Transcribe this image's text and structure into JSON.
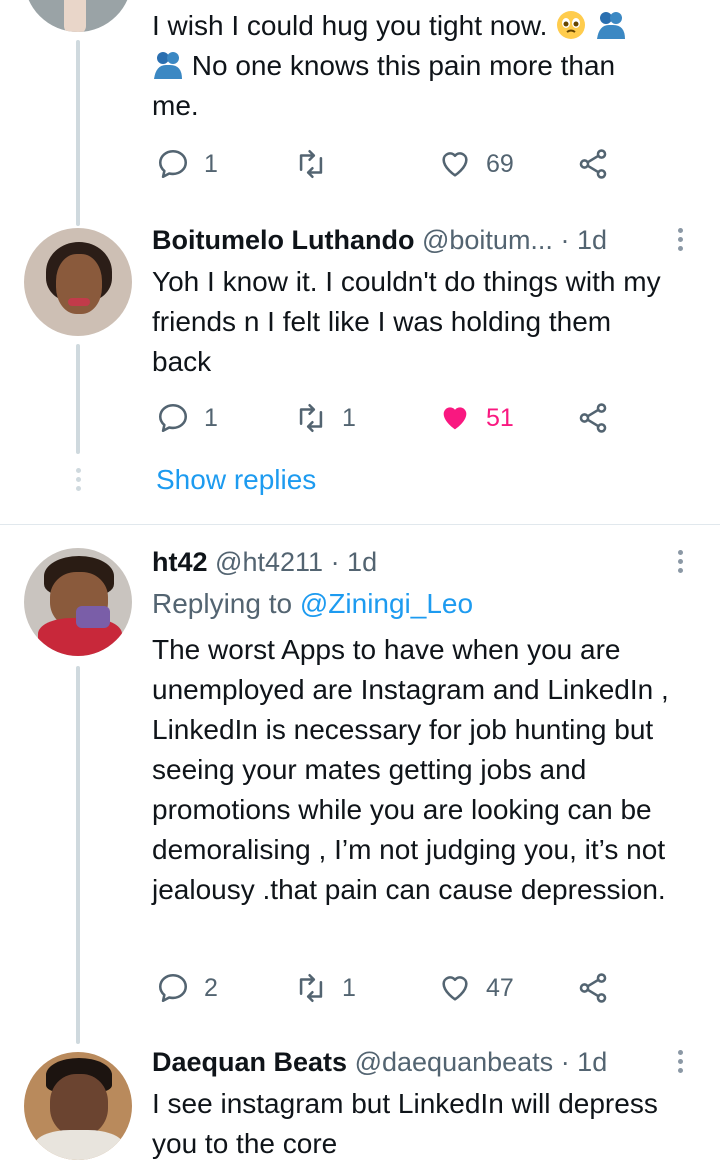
{
  "tweets": [
    {
      "id": "t0",
      "text_line1": "I wish I could hug you tight now.",
      "text_line2": "No one knows this pain more than",
      "text_line3": "me.",
      "emoji1": "pleading-face-icon",
      "emoji2": "people-hugging-icon",
      "emoji3": "people-hugging-icon",
      "replies": "1",
      "retweets": "",
      "likes": "69"
    },
    {
      "id": "t1",
      "name": "Boitumelo Luthando",
      "handle": "@boitum...",
      "time": "· 1d",
      "text": "Yoh I know it. I couldn't do things with my friends n I felt like I was holding them back",
      "replies": "1",
      "retweets": "1",
      "likes": "51",
      "liked": true,
      "show_replies": "Show replies"
    },
    {
      "id": "t2",
      "name": "ht42",
      "handle": "@ht4211",
      "time": "· 1d",
      "replying_prefix": "Replying to",
      "replying_to": "@Ziningi_Leo",
      "text": "The worst Apps to have when you are unemployed are Instagram and LinkedIn , LinkedIn is necessary for job hunting but seeing your mates getting jobs and promotions while you are looking can be demoralising , I’m not judging you, it’s not jealousy .that pain can cause depression.",
      "replies": "2",
      "retweets": "1",
      "likes": "47"
    },
    {
      "id": "t3",
      "name": "Daequan Beats",
      "handle": "@daequanbeats",
      "time": "· 1d",
      "text": "I see instagram but LinkedIn will depress you to the core"
    }
  ],
  "colors": {
    "accent": "#1d9bf0",
    "like": "#f91880",
    "muted": "#536471",
    "thread": "#cfd9de"
  }
}
